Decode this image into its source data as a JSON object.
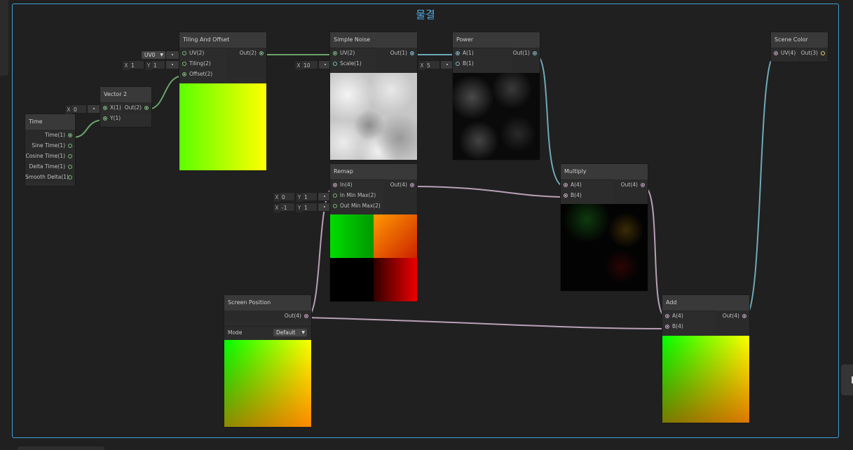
{
  "group": {
    "title": "물결",
    "accent": "#3f9fd6"
  },
  "colors": {
    "green_wire": "#6aa56a",
    "teal_wire": "#6fa9b8",
    "pink_wire": "#b8a0b6"
  },
  "nodes": {
    "time": {
      "title": "Time",
      "outputs": [
        "Time(1)",
        "Sine Time(1)",
        "Cosine Time(1)",
        "Delta Time(1)",
        "Smooth Delta(1)"
      ]
    },
    "vector2": {
      "title": "Vector 2",
      "inputs": [
        "X(1)",
        "Y(1)"
      ],
      "outputs": [
        "Out(2)"
      ],
      "x_axis": "X",
      "x_value": "0"
    },
    "tiling": {
      "title": "Tiling And Offset",
      "inputs": [
        "UV(2)",
        "Tiling(2)",
        "Offset(2)"
      ],
      "outputs": [
        "Out(2)"
      ],
      "uv_channel": "UV0",
      "tiling_x_axis": "X",
      "tiling_x": "1",
      "tiling_y_axis": "Y",
      "tiling_y": "1"
    },
    "noise": {
      "title": "Simple Noise",
      "inputs": [
        "UV(2)",
        "Scale(1)"
      ],
      "outputs": [
        "Out(1)"
      ],
      "scale_axis": "X",
      "scale_value": "10"
    },
    "power": {
      "title": "Power",
      "inputs": [
        "A(1)",
        "B(1)"
      ],
      "outputs": [
        "Out(1)"
      ],
      "b_axis": "X",
      "b_value": "5"
    },
    "remap": {
      "title": "Remap",
      "inputs": [
        "In(4)",
        "In Min Max(2)",
        "Out Min Max(2)"
      ],
      "outputs": [
        "Out(4)"
      ],
      "in_min_axis": "X",
      "in_min": "0",
      "in_max_axis": "Y",
      "in_max": "1",
      "out_min_axis": "X",
      "out_min": "-1",
      "out_max_axis": "Y",
      "out_max": "1"
    },
    "multiply": {
      "title": "Multiply",
      "inputs": [
        "A(4)",
        "B(4)"
      ],
      "outputs": [
        "Out(4)"
      ]
    },
    "screen_position": {
      "title": "Screen Position",
      "outputs": [
        "Out(4)"
      ],
      "mode_label": "Mode",
      "mode_value": "Default"
    },
    "add": {
      "title": "Add",
      "inputs": [
        "A(4)",
        "B(4)"
      ],
      "outputs": [
        "Out(4)"
      ]
    },
    "scene_color": {
      "title": "Scene Color",
      "inputs": [
        "UV(4)"
      ],
      "outputs": [
        "Out(3)"
      ]
    }
  }
}
